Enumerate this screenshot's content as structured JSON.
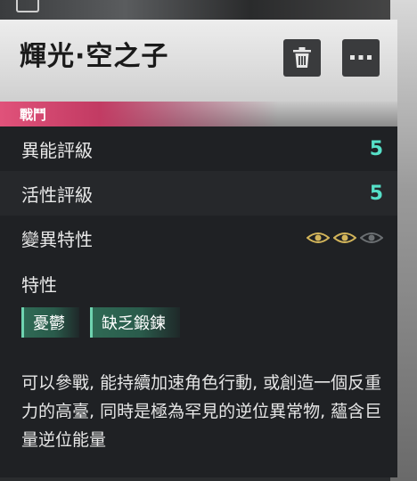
{
  "card": {
    "title": "輝光·空之子",
    "category": "戰鬥",
    "stats": [
      {
        "label": "異能評級",
        "value": "5"
      },
      {
        "label": "活性評級",
        "value": "5"
      }
    ],
    "variation": {
      "label": "變異特性",
      "level": 2,
      "max": 3
    },
    "traits": {
      "label": "特性",
      "tags": [
        "憂鬱",
        "缺乏鍛鍊"
      ]
    },
    "description": "可以參戰, 能持續加速角色行動, 或創造一個反重力的高臺, 同時是極為罕見的逆位異常物, 蘊含巨量逆位能量"
  },
  "colors": {
    "accent_value": "#56e0c8",
    "category_accent": "#e0527a",
    "eye_active": "#d2b45a",
    "eye_inactive": "#6b6f72"
  },
  "icons": {
    "delete": "trash-icon",
    "more": "more-dots-icon",
    "variation": "eye-icon"
  }
}
